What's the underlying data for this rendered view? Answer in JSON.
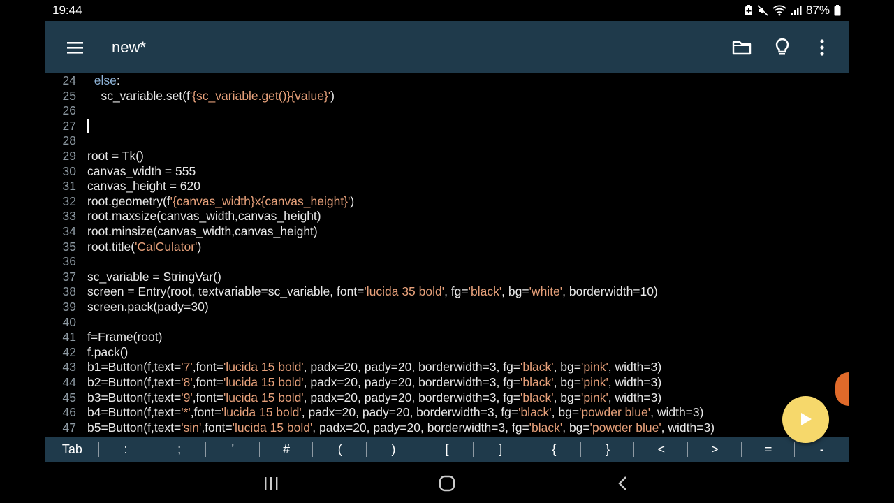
{
  "status": {
    "time": "19:44",
    "battery": "87%"
  },
  "toolbar": {
    "title": "new*"
  },
  "icons": {
    "menu": "menu-icon",
    "folder": "folder-icon",
    "bulb": "lightbulb-icon",
    "more": "more-vert-icon",
    "run": "play-icon"
  },
  "colors": {
    "toolbar": "#1f3a4b",
    "keyword": "#8fb5d9",
    "string": "#e6a07a",
    "fab": "#f6d86b"
  },
  "editor": {
    "lines": [
      {
        "num": "24",
        "parts": [
          [
            "",
            "  "
          ],
          [
            "kw",
            "else"
          ],
          [
            "",
            ":"
          ]
        ]
      },
      {
        "num": "25",
        "parts": [
          [
            "",
            "    sc_variable.set(f"
          ],
          [
            "str",
            "'{sc_variable.get()}{value}'"
          ],
          [
            "",
            ")"
          ]
        ]
      },
      {
        "num": "26",
        "parts": []
      },
      {
        "num": "27",
        "parts": []
      },
      {
        "num": "28",
        "parts": []
      },
      {
        "num": "29",
        "parts": [
          [
            "",
            "root = Tk()"
          ]
        ]
      },
      {
        "num": "30",
        "parts": [
          [
            "",
            "canvas_width = 555"
          ]
        ]
      },
      {
        "num": "31",
        "parts": [
          [
            "",
            "canvas_height = 620"
          ]
        ]
      },
      {
        "num": "32",
        "parts": [
          [
            "",
            "root.geometry(f"
          ],
          [
            "str",
            "'{canvas_width}x{canvas_height}'"
          ],
          [
            "",
            ")"
          ]
        ]
      },
      {
        "num": "33",
        "parts": [
          [
            "",
            "root.maxsize(canvas_width,canvas_height)"
          ]
        ]
      },
      {
        "num": "34",
        "parts": [
          [
            "",
            "root.minsize(canvas_width,canvas_height)"
          ]
        ]
      },
      {
        "num": "35",
        "parts": [
          [
            "",
            "root.title("
          ],
          [
            "str",
            "'CalCulator'"
          ],
          [
            "",
            ")"
          ]
        ]
      },
      {
        "num": "36",
        "parts": []
      },
      {
        "num": "37",
        "parts": [
          [
            "",
            "sc_variable = StringVar()"
          ]
        ]
      },
      {
        "num": "38",
        "parts": [
          [
            "",
            "screen = Entry(root, textvariable=sc_variable, font="
          ],
          [
            "str",
            "'lucida 35 bold'"
          ],
          [
            "",
            ", fg="
          ],
          [
            "str",
            "'black'"
          ],
          [
            "",
            ", bg="
          ],
          [
            "str",
            "'white'"
          ],
          [
            "",
            ", borderwidth=10)"
          ]
        ]
      },
      {
        "num": "39",
        "parts": [
          [
            "",
            "screen.pack(pady=30)"
          ]
        ]
      },
      {
        "num": "40",
        "parts": []
      },
      {
        "num": "41",
        "parts": [
          [
            "",
            "f=Frame(root)"
          ]
        ]
      },
      {
        "num": "42",
        "parts": [
          [
            "",
            "f.pack()"
          ]
        ]
      },
      {
        "num": "43",
        "parts": [
          [
            "",
            "b1=Button(f,text="
          ],
          [
            "str",
            "'7'"
          ],
          [
            "",
            ",font="
          ],
          [
            "str",
            "'lucida 15 bold'"
          ],
          [
            "",
            ", padx=20, pady=20, borderwidth=3, fg="
          ],
          [
            "str",
            "'black'"
          ],
          [
            "",
            ", bg="
          ],
          [
            "str",
            "'pink'"
          ],
          [
            "",
            ", width=3)"
          ]
        ]
      },
      {
        "num": "44",
        "parts": [
          [
            "",
            "b2=Button(f,text="
          ],
          [
            "str",
            "'8'"
          ],
          [
            "",
            ",font="
          ],
          [
            "str",
            "'lucida 15 bold'"
          ],
          [
            "",
            ", padx=20, pady=20, borderwidth=3, fg="
          ],
          [
            "str",
            "'black'"
          ],
          [
            "",
            ", bg="
          ],
          [
            "str",
            "'pink'"
          ],
          [
            "",
            ", width=3)"
          ]
        ]
      },
      {
        "num": "45",
        "parts": [
          [
            "",
            "b3=Button(f,text="
          ],
          [
            "str",
            "'9'"
          ],
          [
            "",
            ",font="
          ],
          [
            "str",
            "'lucida 15 bold'"
          ],
          [
            "",
            ", padx=20, pady=20, borderwidth=3, fg="
          ],
          [
            "str",
            "'black'"
          ],
          [
            "",
            ", bg="
          ],
          [
            "str",
            "'pink'"
          ],
          [
            "",
            ", width=3)"
          ]
        ]
      },
      {
        "num": "46",
        "parts": [
          [
            "",
            "b4=Button(f,text="
          ],
          [
            "str",
            "'*'"
          ],
          [
            "",
            ",font="
          ],
          [
            "str",
            "'lucida 15 bold'"
          ],
          [
            "",
            ", padx=20, pady=20, borderwidth=3, fg="
          ],
          [
            "str",
            "'black'"
          ],
          [
            "",
            ", bg="
          ],
          [
            "str",
            "'powder blue'"
          ],
          [
            "",
            ", width=3)"
          ]
        ]
      },
      {
        "num": "47",
        "parts": [
          [
            "",
            "b5=Button(f,text="
          ],
          [
            "str",
            "'sin'"
          ],
          [
            "",
            ",font="
          ],
          [
            "str",
            "'lucida 15 bold'"
          ],
          [
            "",
            ", padx=20, pady=20, borderwidth=3, fg="
          ],
          [
            "str",
            "'black'"
          ],
          [
            "",
            ", bg="
          ],
          [
            "str",
            "'powder blue'"
          ],
          [
            "",
            ", width=3)"
          ]
        ]
      }
    ]
  },
  "keybar": {
    "keys": [
      "Tab",
      ":",
      ";",
      "'",
      "#",
      "(",
      ")",
      "[",
      "]",
      "{",
      "}",
      "<",
      ">",
      "=",
      "-"
    ]
  },
  "navbar": {
    "recent": "recent-apps-icon",
    "home": "home-icon",
    "back": "back-icon"
  }
}
